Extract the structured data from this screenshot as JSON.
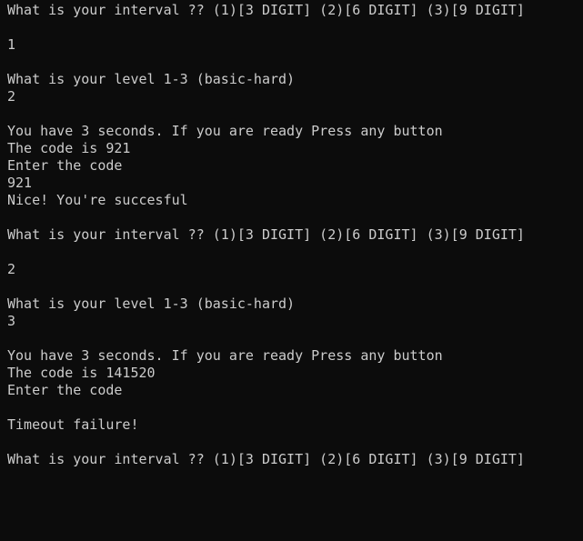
{
  "terminal": {
    "lines": [
      "What is your interval ?? (1)[3 DIGIT] (2)[6 DIGIT] (3)[9 DIGIT]",
      "",
      "1",
      "",
      "What is your level 1-3 (basic-hard)",
      "2",
      "",
      "You have 3 seconds. If you are ready Press any button",
      "The code is 921",
      "Enter the code",
      "921",
      "Nice! You're succesful",
      "",
      "What is your interval ?? (1)[3 DIGIT] (2)[6 DIGIT] (3)[9 DIGIT]",
      "",
      "2",
      "",
      "What is your level 1-3 (basic-hard)",
      "3",
      "",
      "You have 3 seconds. If you are ready Press any button",
      "The code is 141520",
      "Enter the code",
      "",
      "Timeout failure!",
      "",
      "What is your interval ?? (1)[3 DIGIT] (2)[6 DIGIT] (3)[9 DIGIT]",
      ""
    ],
    "colors": {
      "background": "#0c0c0c",
      "foreground": "#cccccc"
    }
  }
}
